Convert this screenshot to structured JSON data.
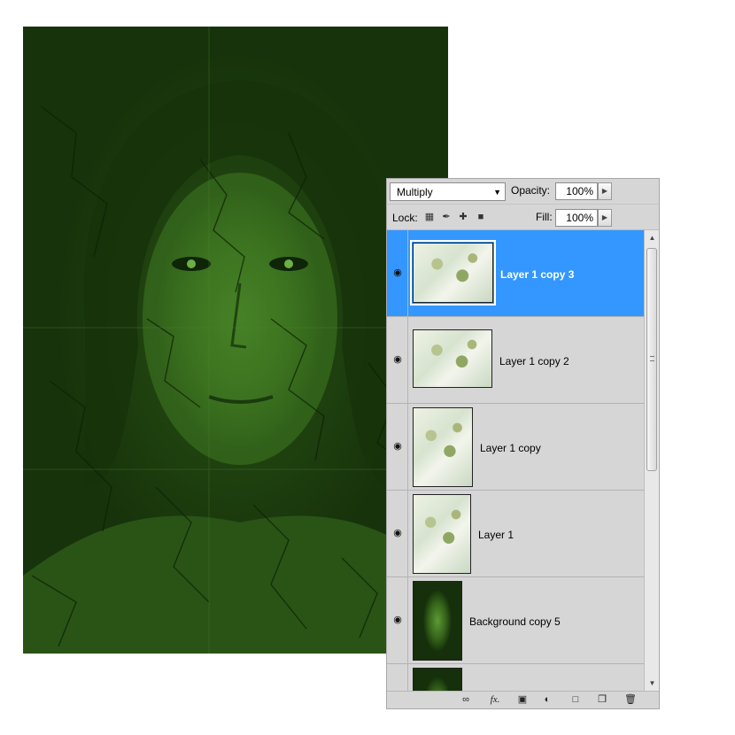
{
  "layers_panel": {
    "blend_mode": "Multiply",
    "opacity_label": "Opacity:",
    "opacity_value": "100%",
    "lock_label": "Lock:",
    "fill_label": "Fill:",
    "fill_value": "100%",
    "layers": [
      {
        "name": "Layer 1 copy 3",
        "selected": true,
        "visible": true
      },
      {
        "name": "Layer 1 copy 2",
        "selected": false,
        "visible": true
      },
      {
        "name": "Layer 1 copy",
        "selected": false,
        "visible": true
      },
      {
        "name": "Layer 1",
        "selected": false,
        "visible": true
      },
      {
        "name": "Background  copy 5",
        "selected": false,
        "visible": true
      },
      {
        "name": "",
        "selected": false,
        "visible": false
      }
    ],
    "footer_icons": [
      "link-icon",
      "fx-icon",
      "mask-icon",
      "adjustment-icon",
      "folder-icon",
      "new-layer-icon",
      "trash-icon"
    ],
    "footer_fx": "fx."
  },
  "colors": {
    "selection": "#3397ff",
    "panel_bg": "#d6d6d6",
    "canvas_tint": "#2c5c18"
  }
}
